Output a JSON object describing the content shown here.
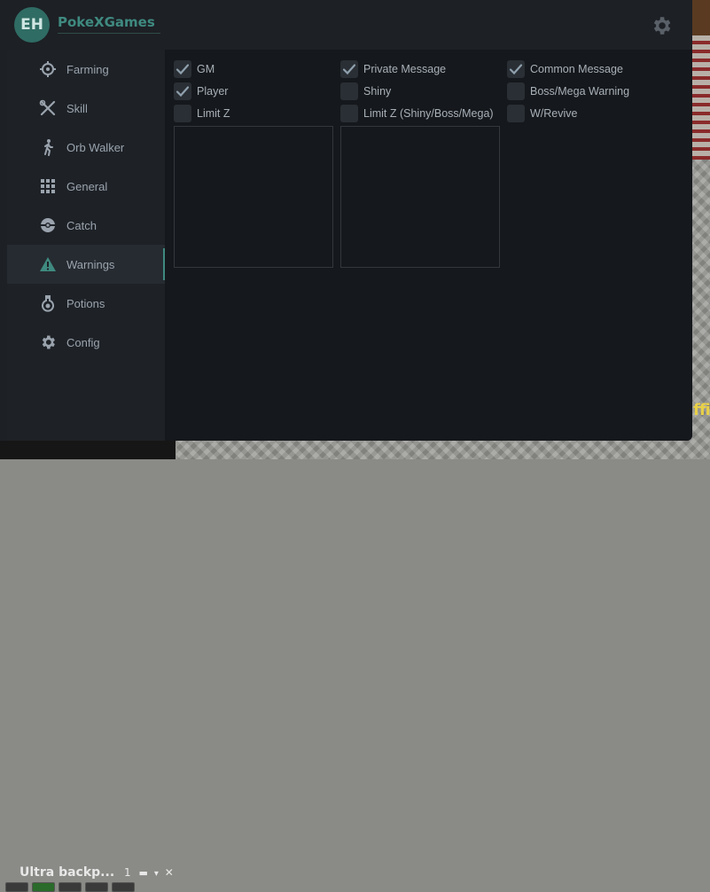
{
  "header": {
    "avatar_initials": "EH",
    "brand": "PokeXGames",
    "settings_icon": "gear-icon"
  },
  "sidebar": {
    "items": [
      {
        "label": "Farming",
        "icon": "crosshair-icon",
        "active": false
      },
      {
        "label": "Skill",
        "icon": "crossed-tools-icon",
        "active": false
      },
      {
        "label": "Orb Walker",
        "icon": "walking-person-icon",
        "active": false
      },
      {
        "label": "General",
        "icon": "grid-icon",
        "active": false
      },
      {
        "label": "Catch",
        "icon": "pokeball-icon",
        "active": false
      },
      {
        "label": "Warnings",
        "icon": "warning-triangle-icon",
        "active": true
      },
      {
        "label": "Potions",
        "icon": "potion-icon",
        "active": false
      },
      {
        "label": "Config",
        "icon": "gear-icon",
        "active": false
      }
    ]
  },
  "warnings": {
    "checkboxes": [
      {
        "label": "GM",
        "checked": true
      },
      {
        "label": "Private Message",
        "checked": true
      },
      {
        "label": "Common Message",
        "checked": true
      },
      {
        "label": "Player",
        "checked": true
      },
      {
        "label": "Shiny",
        "checked": false
      },
      {
        "label": "Boss/Mega Warning",
        "checked": false
      },
      {
        "label": "Limit Z",
        "checked": false
      },
      {
        "label": "Limit Z (Shiny/Boss/Mega)",
        "checked": false
      },
      {
        "label": "W/Revive",
        "checked": false
      }
    ]
  },
  "game": {
    "backpack_title": "Ultra backp...",
    "backpack_count": "1",
    "side_text": "ffi"
  },
  "colors": {
    "accent": "#3f8a80",
    "window_bg": "#1d2025",
    "content_bg": "#15181c",
    "checkbox_bg": "#2a2f35",
    "text": "#a8b0b8"
  }
}
